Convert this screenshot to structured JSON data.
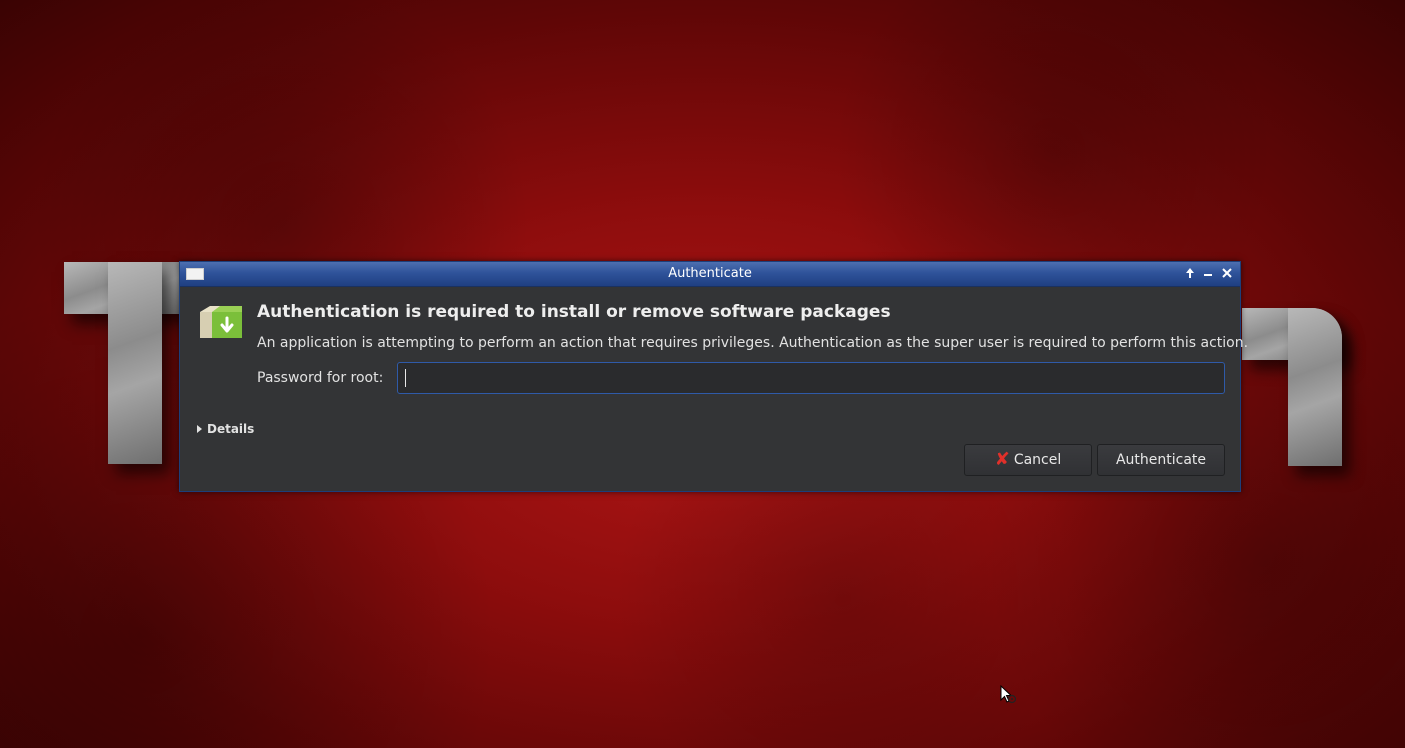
{
  "window": {
    "title": "Authenticate",
    "controls": {
      "shade_glyph": "🡑",
      "minimize_glyph": "‒",
      "close_glyph": "✕"
    }
  },
  "dialog": {
    "icon": "package-install-icon",
    "heading": "Authentication is required to install or remove software packages",
    "description": "An application is attempting to perform an action that requires privileges. Authentication as the super user is required to perform this action.",
    "password_label": "Password for root:",
    "password_value": "",
    "details_label": "Details",
    "cancel_icon": "cancel-x-icon",
    "cancel_glyph": "✘",
    "cancel_label": "Cancel",
    "authenticate_label": "Authenticate"
  },
  "colors": {
    "titlebar": "#2f539a",
    "dialog_bg": "#333436",
    "input_focus": "#2f5aa8",
    "cancel_icon": "#e0302a"
  }
}
